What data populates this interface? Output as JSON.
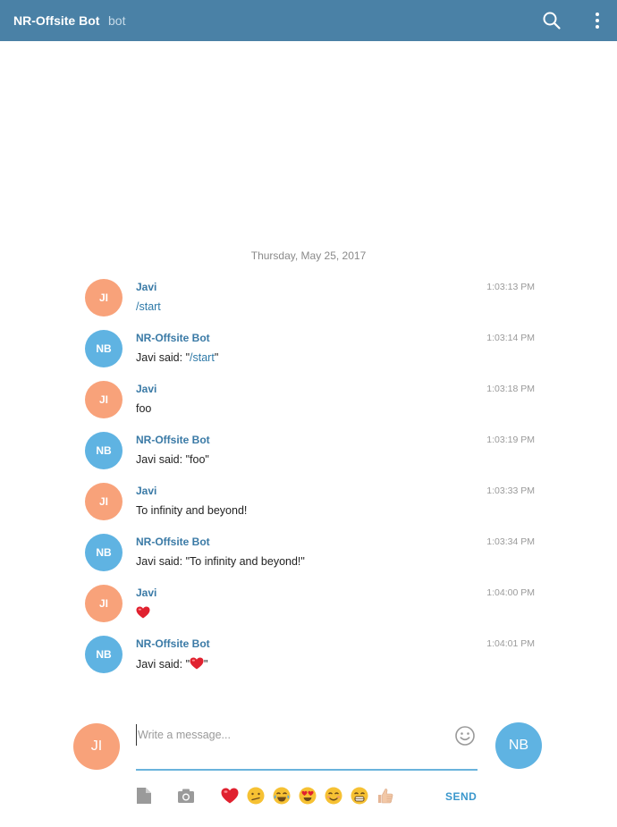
{
  "header": {
    "title": "NR-Offsite Bot",
    "subtitle": "bot",
    "icons": [
      "search-icon",
      "more-vertical-icon"
    ]
  },
  "date_separator": "Thursday, May 25, 2017",
  "messages": [
    {
      "avatar": "JI",
      "name": "Javi",
      "time": "1:03:13 PM",
      "text": "/start"
    },
    {
      "avatar": "NB",
      "name": "NR-Offsite Bot",
      "time": "1:03:14 PM",
      "text_prefix": "Javi said: \"",
      "text_cmd": "/start",
      "text_suffix": "\""
    },
    {
      "avatar": "JI",
      "name": "Javi",
      "time": "1:03:18 PM",
      "text": "foo"
    },
    {
      "avatar": "NB",
      "name": "NR-Offsite Bot",
      "time": "1:03:19 PM",
      "text": "Javi said: \"foo\""
    },
    {
      "avatar": "JI",
      "name": "Javi",
      "time": "1:03:33 PM",
      "text": "To infinity and beyond!"
    },
    {
      "avatar": "NB",
      "name": "NR-Offsite Bot",
      "time": "1:03:34 PM",
      "text": "Javi said: \"To infinity and beyond!\""
    },
    {
      "avatar": "JI",
      "name": "Javi",
      "time": "1:04:00 PM",
      "emoji": "heart-emoji"
    },
    {
      "avatar": "NB",
      "name": "NR-Offsite Bot",
      "time": "1:04:01 PM",
      "text_prefix": "Javi said: \"",
      "emoji": "heart-emoji",
      "text_suffix": "\""
    }
  ],
  "composer": {
    "user_avatar": "JI",
    "bot_avatar": "NB",
    "placeholder": "Write a message...",
    "value": "",
    "send_label": "SEND",
    "quick_emojis": [
      "heart",
      "confused-face",
      "tears-of-joy-face",
      "heart-eyes-face",
      "smiling-face",
      "grinning-face",
      "thumbs-up"
    ]
  },
  "colors": {
    "header_bg": "#4a81a6",
    "user_avatar": "#f8a27a",
    "bot_avatar": "#5fb3e2",
    "name": "#3a7aa6",
    "accent": "#3a97cc"
  }
}
